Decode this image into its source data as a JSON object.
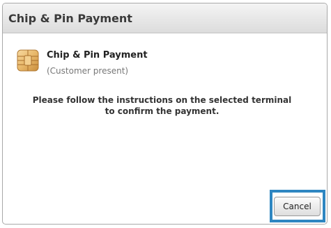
{
  "dialog": {
    "title": "Chip & Pin Payment"
  },
  "payment_method": {
    "icon": "chip-card-icon",
    "title": "Chip & Pin Payment",
    "subtitle": "(Customer present)"
  },
  "instructions": "Please follow the instructions on the selected terminal to confirm the payment.",
  "actions": {
    "cancel_label": "Cancel"
  },
  "colors": {
    "focus_ring": "#2e86c1",
    "chip_gold": "#e8b86a"
  }
}
